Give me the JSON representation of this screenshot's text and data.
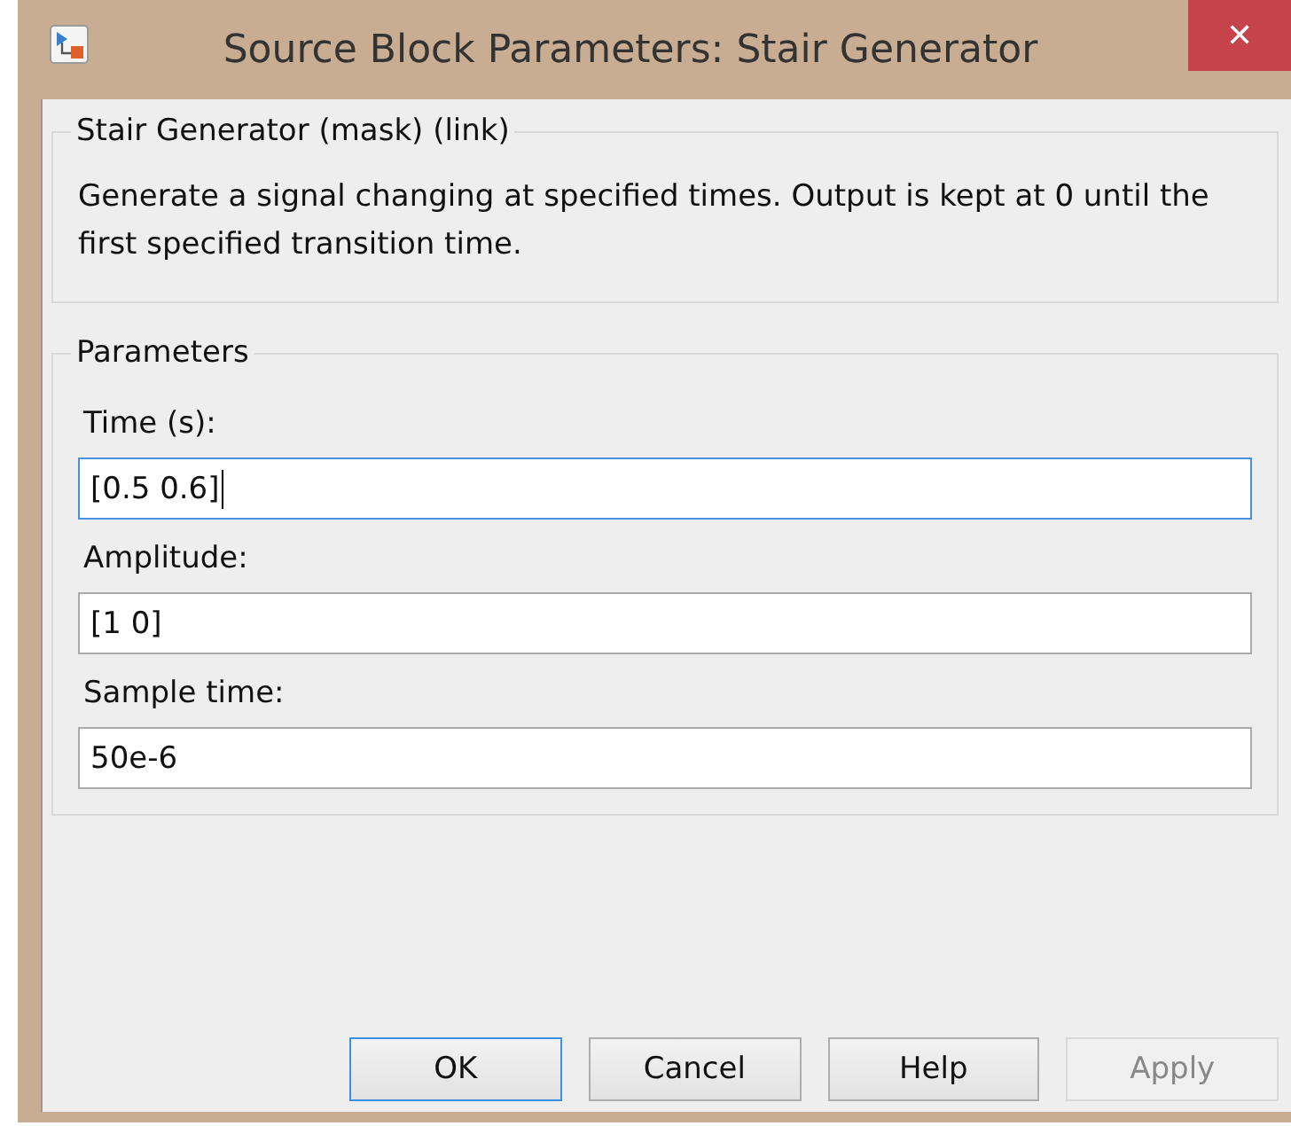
{
  "window": {
    "title": "Source Block Parameters: Stair Generator",
    "close": "✕"
  },
  "description_group": {
    "title": "Stair Generator (mask) (link)",
    "text": "Generate a signal changing at specified times. Output is kept at 0 until the first specified transition time."
  },
  "parameters": {
    "title": "Parameters",
    "fields": [
      {
        "label": "Time (s):",
        "value": "[0.5 0.6]",
        "focused": true
      },
      {
        "label": "Amplitude:",
        "value": "[1 0]",
        "focused": false
      },
      {
        "label": "Sample time:",
        "value": "50e-6",
        "focused": false
      }
    ]
  },
  "buttons": [
    {
      "label": "OK",
      "default": true,
      "disabled": false
    },
    {
      "label": "Cancel",
      "default": false,
      "disabled": false
    },
    {
      "label": "Help",
      "default": false,
      "disabled": false
    },
    {
      "label": "Apply",
      "default": false,
      "disabled": true
    }
  ]
}
